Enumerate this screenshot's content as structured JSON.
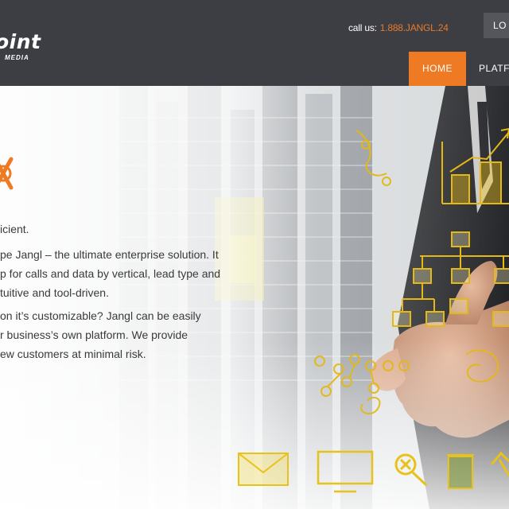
{
  "header": {
    "logo_text": "oint",
    "logo_sub": "MEDIA",
    "call_label": "call us:",
    "call_number": "1.888.JANGL.24",
    "login_label": "LO",
    "nav": [
      {
        "label": "HOME",
        "active": true
      },
      {
        "label": "PLATF",
        "active": false
      }
    ]
  },
  "hero": {
    "lines": [
      "icient.",
      "pe Jangl – the ultimate enterprise solution. It",
      "p for calls and data by vertical, lead type and",
      "tuitive and tool-driven.",
      "on it’s customizable? Jangl can be easily",
      "r business’s own platform. We provide",
      "ew customers at minimal risk."
    ]
  },
  "colors": {
    "header_bg": "#3d3e44",
    "accent": "#ef7a24",
    "doodle_yellow": "#f2c417"
  },
  "icons": [
    "logo-x-icon",
    "envelope-icon",
    "monitor-icon",
    "magnifier-icon",
    "trash-icon",
    "hammer-icon",
    "bar-chart-icon",
    "org-chart-icon"
  ]
}
